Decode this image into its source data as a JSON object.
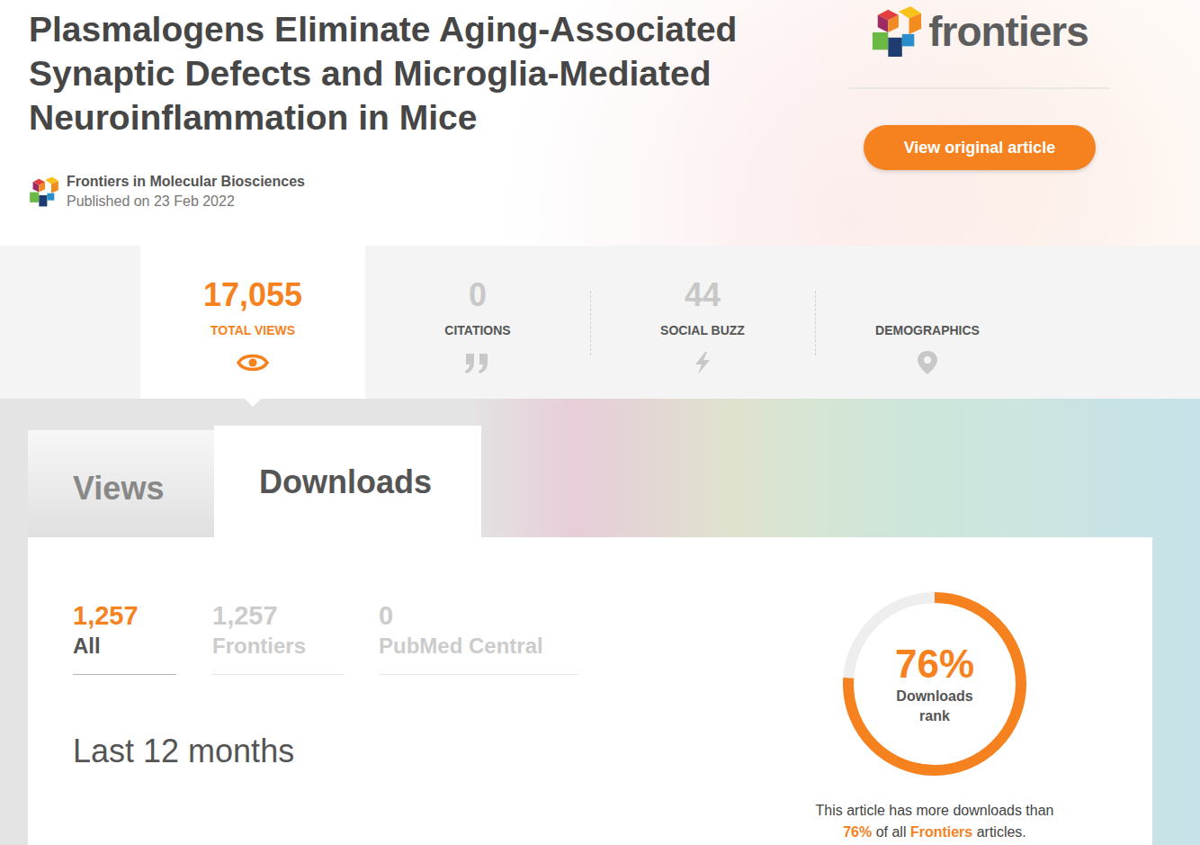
{
  "article": {
    "title": "Plasmalogens Eliminate Aging-Associated Synaptic Defects and Microglia-Mediated Neuroinflammation in Mice",
    "journal": "Frontiers in Molecular Biosciences",
    "published": "Published on 23 Feb 2022"
  },
  "brand": {
    "name": "frontiers"
  },
  "button": "View original article",
  "metrics": [
    {
      "value": "17,055",
      "label": "TOTAL VIEWS",
      "kind": "eye",
      "selected": true
    },
    {
      "value": "0",
      "label": "CITATIONS",
      "kind": "quote",
      "selected": false
    },
    {
      "value": "44",
      "label": "SOCIAL BUZZ",
      "kind": "bolt",
      "selected": false
    },
    {
      "value": "",
      "label": "DEMOGRAPHICS",
      "kind": "pin",
      "selected": false
    }
  ],
  "tabs": [
    {
      "label": "Views",
      "selected": false
    },
    {
      "label": "Downloads",
      "selected": true
    }
  ],
  "filters": [
    {
      "value": "1,257",
      "label": "All",
      "selected": true
    },
    {
      "value": "1,257",
      "label": "Frontiers",
      "selected": false
    },
    {
      "value": "0",
      "label": "PubMed Central",
      "selected": false
    }
  ],
  "period": "Last 12 months",
  "rank": {
    "value": "76%",
    "label": "Downloads rank",
    "level": 0.76
  },
  "summary": {
    "before": "This article has more downloads than",
    "percent": "76%",
    "middle": "of all",
    "brand": "Frontiers",
    "after": "articles."
  }
}
